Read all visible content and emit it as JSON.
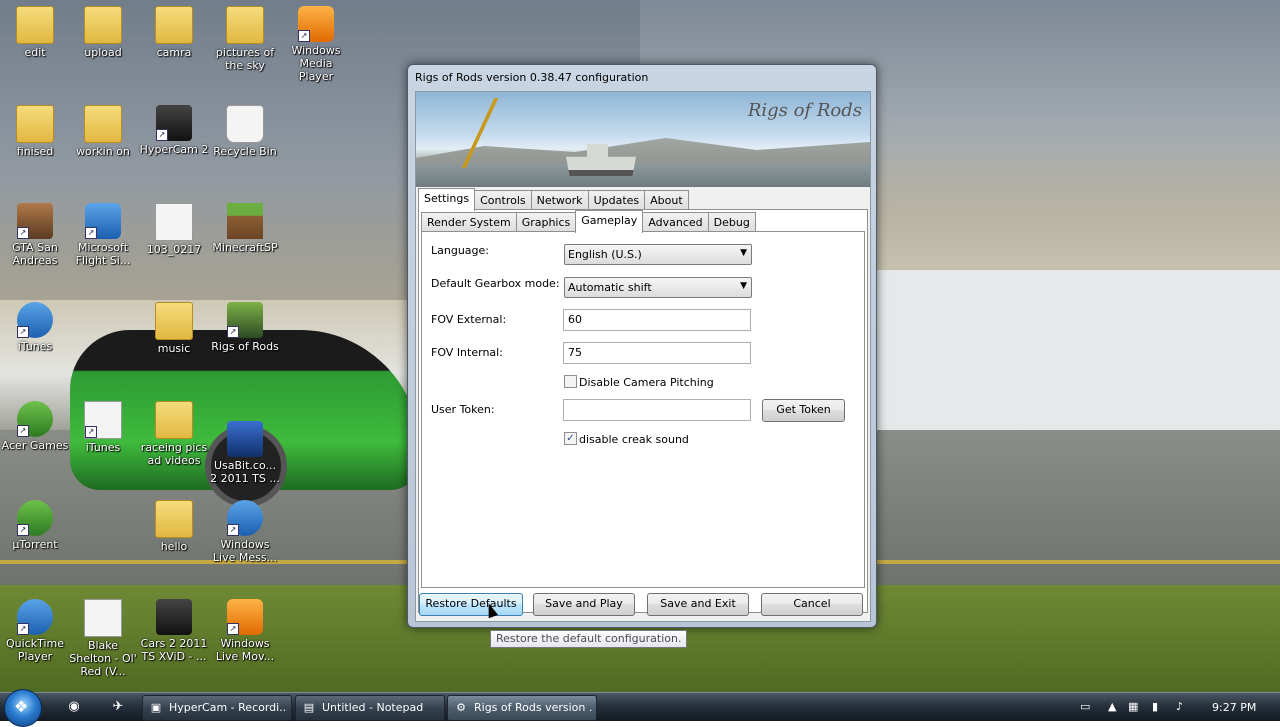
{
  "desktop": {
    "icons": [
      {
        "label": "edit",
        "icon": "folder-icon"
      },
      {
        "label": "upload",
        "icon": "folder-icon"
      },
      {
        "label": "camra",
        "icon": "folder-icon"
      },
      {
        "label": "pictures of the sky",
        "icon": "folder-icon"
      },
      {
        "label": "Windows Media Player",
        "icon": "media-player-icon"
      },
      {
        "label": "finised",
        "icon": "folder-icon"
      },
      {
        "label": "workin on",
        "icon": "folder-icon"
      },
      {
        "label": "HyperCam 2",
        "icon": "hypercam-icon"
      },
      {
        "label": "Recycle Bin",
        "icon": "recycle-bin-icon"
      },
      {
        "label": "GTA San Andreas",
        "icon": "gta-icon"
      },
      {
        "label": "Microsoft Flight Si...",
        "icon": "flight-sim-icon"
      },
      {
        "label": "103_0217",
        "icon": "audio-file-icon"
      },
      {
        "label": "MinecraftSP",
        "icon": "minecraft-icon"
      },
      {
        "label": "iTunes",
        "icon": "itunes-icon"
      },
      {
        "label": "music",
        "icon": "folder-icon"
      },
      {
        "label": "Rigs of Rods",
        "icon": "rigs-of-rods-icon"
      },
      {
        "label": "Acer Games",
        "icon": "acer-games-icon"
      },
      {
        "label": "iTunes",
        "icon": "itunes-file-icon"
      },
      {
        "label": "raceing pics ad videos",
        "icon": "folder-icon"
      },
      {
        "label": "UsaBit.co... 2 2011 TS ...",
        "icon": "video-file-icon"
      },
      {
        "label": "µTorrent",
        "icon": "utorrent-icon"
      },
      {
        "label": "hello",
        "icon": "folder-icon"
      },
      {
        "label": "Windows Live Mess...",
        "icon": "messenger-icon"
      },
      {
        "label": "QuickTime Player",
        "icon": "quicktime-icon"
      },
      {
        "label": "Blake Shelton - Ol' Red (V...",
        "icon": "mp3-file-icon"
      },
      {
        "label": "Cars 2 2011 TS XViD - ...",
        "icon": "video-file-icon"
      },
      {
        "label": "Windows Live Mov...",
        "icon": "movie-maker-icon"
      }
    ]
  },
  "dialog": {
    "title": "Rigs of Rods version 0.38.47 configuration",
    "banner_logo": "Rigs of Rods",
    "main_tabs": [
      "Settings",
      "Controls",
      "Network",
      "Updates",
      "About"
    ],
    "active_main_tab": "Settings",
    "sub_tabs": [
      "Render System",
      "Graphics",
      "Gameplay",
      "Advanced",
      "Debug"
    ],
    "active_sub_tab": "Gameplay",
    "gameplay": {
      "language_label": "Language:",
      "language_value": "English (U.S.)",
      "gearbox_label": "Default Gearbox mode:",
      "gearbox_value": "Automatic shift",
      "fov_external_label": "FOV External:",
      "fov_external_value": "60",
      "fov_internal_label": "FOV Internal:",
      "fov_internal_value": "75",
      "disable_camera_pitching_label": "Disable Camera Pitching",
      "disable_camera_pitching_checked": false,
      "user_token_label": "User Token:",
      "user_token_value": "",
      "get_token_label": "Get Token",
      "disable_creak_label": "disable creak sound",
      "disable_creak_checked": true
    },
    "buttons": {
      "restore": "Restore Defaults",
      "save_play": "Save and Play",
      "save_exit": "Save and Exit",
      "cancel": "Cancel"
    },
    "tooltip": "Restore the default configuration."
  },
  "taskbar": {
    "tasks": [
      {
        "label": "HyperCam - Recordi...",
        "icon": "hypercam-icon"
      },
      {
        "label": "Untitled - Notepad",
        "icon": "notepad-icon"
      },
      {
        "label": "Rigs of Rods version ...",
        "icon": "rigs-of-rods-icon"
      }
    ],
    "clock": "9:27 PM"
  },
  "colors": {
    "accent": "#3c7fb1",
    "window_frame": "#c9d5e2",
    "taskbar": "#27313c"
  }
}
